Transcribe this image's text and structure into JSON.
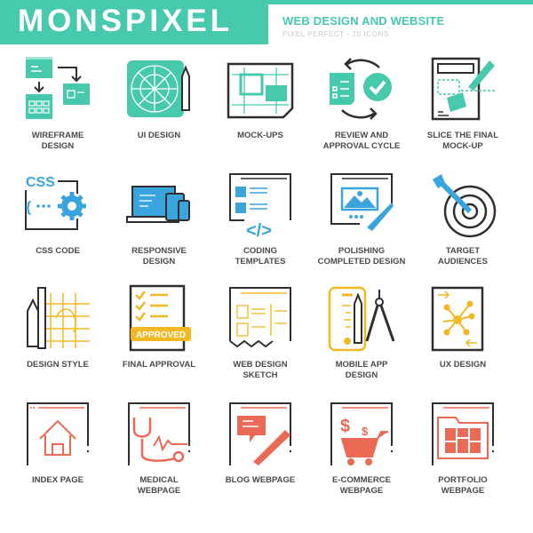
{
  "header": {
    "brand": "MONSPIXEL",
    "title": "WEB DESIGN AND WEBSITE",
    "tagline": "PIXEL PERFECT - 20 ICONS"
  },
  "colors": {
    "teal": "#47c9ad",
    "blue": "#3aa4dc",
    "yellow": "#f2b824",
    "coral": "#ea6a55",
    "dark": "#2f2f2f",
    "label": "#4a4a4a"
  },
  "rows": [
    {
      "theme": "teal",
      "icons": [
        {
          "name": "wireframe-design",
          "label": "WIREFRAME\nDESIGN"
        },
        {
          "name": "ui-design",
          "label": "UI DESIGN"
        },
        {
          "name": "mock-ups",
          "label": "MOCK-UPS"
        },
        {
          "name": "review-and-approval-cycle",
          "label": "REVIEW AND\nAPPROVAL CYCLE"
        },
        {
          "name": "slice-the-final-mock-up",
          "label": "SLICE THE FINAL\nMOCK-UP"
        }
      ]
    },
    {
      "theme": "blue",
      "icons": [
        {
          "name": "css-code",
          "label": "CSS CODE",
          "badge": "CSS"
        },
        {
          "name": "responsive-design",
          "label": "RESPONSIVE\nDESIGN"
        },
        {
          "name": "coding-templates",
          "label": "CODING\nTEMPLATES"
        },
        {
          "name": "polishing-completed-design",
          "label": "POLISHING\nCOMPLETED DESIGN"
        },
        {
          "name": "target-audiences",
          "label": "TARGET\nAUDIENCES"
        }
      ]
    },
    {
      "theme": "yellow",
      "icons": [
        {
          "name": "design-style",
          "label": "DESIGN STYLE"
        },
        {
          "name": "final-approval",
          "label": "FINAL APPROVAL",
          "badge": "APPROVED"
        },
        {
          "name": "web-design-sketch",
          "label": "WEB DESIGN\nSKETCH"
        },
        {
          "name": "mobile-app-design",
          "label": "MOBILE APP\nDESIGN"
        },
        {
          "name": "ux-design",
          "label": "UX DESIGN"
        }
      ]
    },
    {
      "theme": "coral",
      "icons": [
        {
          "name": "index-page",
          "label": "INDEX PAGE"
        },
        {
          "name": "medical-webpage",
          "label": "MEDICAL\nWEBPAGE"
        },
        {
          "name": "blog-webpage",
          "label": "BLOG WEBPAGE"
        },
        {
          "name": "e-commerce-webpage",
          "label": "E-COMMERCE\nWEBPAGE",
          "badge": "$"
        },
        {
          "name": "portfolio-webpage",
          "label": "PORTFOLIO\nWEBPAGE"
        }
      ]
    }
  ]
}
